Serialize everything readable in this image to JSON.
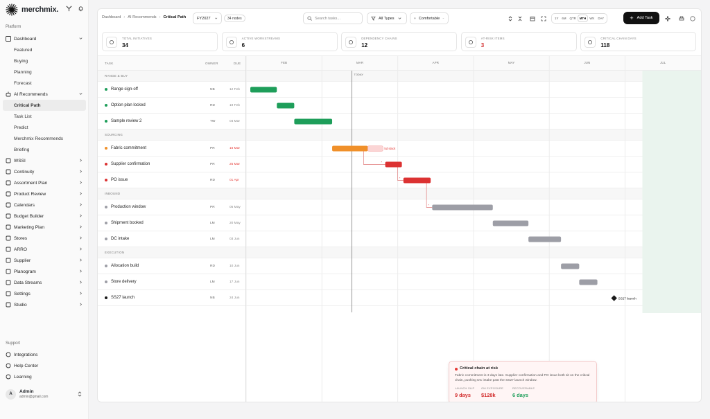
{
  "brand": {
    "name": "merchmix."
  },
  "sidebar": {
    "platform_label": "Platform",
    "support_label": "Support",
    "dashboard": {
      "label": "Dashboard",
      "children": [
        "Featured",
        "Buying",
        "Planning",
        "Forecast"
      ]
    },
    "ai": {
      "label": "AI Recommends",
      "children": [
        "Critical Path",
        "Task List",
        "Predict",
        "Merchmix Recommends",
        "Briefing"
      ]
    },
    "items": [
      "WSSI",
      "Continuity",
      "Assortment Plan",
      "Product Review",
      "Calendars",
      "Budget Builder",
      "Marketing Plan",
      "Stores",
      "ARRO",
      "Supplier",
      "Planogram",
      "Data Streams",
      "Settings",
      "Studio"
    ],
    "support": [
      "Integrations",
      "Help Center",
      "Learning"
    ],
    "user": {
      "initial": "A",
      "name": "Admin",
      "email": "admin@gmail.com"
    }
  },
  "topbar": {
    "crumbs": [
      "Dashboard",
      "AI Recommends",
      "Critical Path"
    ],
    "year": "FY2027",
    "nodes": "34 nodes",
    "search_placeholder": "Search tasks...",
    "filter": "All Types",
    "density": "Comfortable",
    "ranges": [
      "1Y",
      "6M",
      "QTR",
      "MTH",
      "WK",
      "DAY"
    ],
    "range_active": "MTH",
    "add_label": "Add Task"
  },
  "kpis": [
    {
      "label": "TOTAL INITIATIVES",
      "value": "34",
      "icon": "layers-icon",
      "tone": "normal"
    },
    {
      "label": "ACTIVE WORKSTREAMS",
      "value": "6",
      "icon": "pulse-icon",
      "tone": "normal"
    },
    {
      "label": "DEPENDENCY CHAINS",
      "value": "12",
      "icon": "link-icon",
      "tone": "normal"
    },
    {
      "label": "AT-RISK ITEMS",
      "value": "3",
      "icon": "warning-icon",
      "tone": "red"
    },
    {
      "label": "CRITICAL CHAIN DAYS",
      "value": "118",
      "icon": "swap-icon",
      "tone": "normal"
    }
  ],
  "gantt": {
    "headers": {
      "task": "TASK",
      "owner": "OWNER",
      "due": "DUE"
    },
    "months": [
      "FEB",
      "MAR",
      "APR",
      "MAY",
      "JUN",
      "JUL"
    ],
    "today_label": "TODAY",
    "slack_label": "5d slack",
    "milestone_label": "SS27 launch",
    "rows": [
      {
        "kind": "group",
        "label": "RANGE & BUY"
      },
      {
        "kind": "task",
        "name": "Range sign-off",
        "owner": "NB",
        "due": "12 Feb",
        "due_red": false,
        "status": "green",
        "start": 0.0,
        "end": 0.35
      },
      {
        "kind": "task",
        "name": "Option plan locked",
        "owner": "RD",
        "due": "19 Feb",
        "due_red": false,
        "status": "green",
        "start": 0.35,
        "end": 0.58
      },
      {
        "kind": "task",
        "name": "Sample review 2",
        "owner": "TW",
        "due": "04 Mar",
        "due_red": false,
        "status": "green",
        "start": 0.58,
        "end": 1.08
      },
      {
        "kind": "group",
        "label": "SOURCING"
      },
      {
        "kind": "task",
        "name": "Fabric commitment",
        "owner": "PR",
        "due": "16 Mar",
        "due_red": true,
        "status": "orange",
        "start": 1.08,
        "end": 1.55,
        "slack_end": 1.75
      },
      {
        "kind": "task",
        "name": "Supplier confirmation",
        "owner": "PR",
        "due": "25 Mar",
        "due_red": true,
        "status": "red",
        "start": 1.78,
        "end": 2.0
      },
      {
        "kind": "task",
        "name": "PO issue",
        "owner": "RD",
        "due": "01 Apr",
        "due_red": true,
        "status": "red",
        "start": 2.02,
        "end": 2.38
      },
      {
        "kind": "group",
        "label": "INBOUND"
      },
      {
        "kind": "task",
        "name": "Production window",
        "owner": "PR",
        "due": "05 May",
        "due_red": false,
        "status": "gray",
        "start": 2.4,
        "end": 3.2
      },
      {
        "kind": "task",
        "name": "Shipment booked",
        "owner": "LM",
        "due": "20 May",
        "due_red": false,
        "status": "gray",
        "start": 3.2,
        "end": 3.67
      },
      {
        "kind": "task",
        "name": "DC intake",
        "owner": "LM",
        "due": "03 Jun",
        "due_red": false,
        "status": "gray",
        "start": 3.67,
        "end": 4.1
      },
      {
        "kind": "group",
        "label": "EXECUTION"
      },
      {
        "kind": "task",
        "name": "Allocation build",
        "owner": "RD",
        "due": "10 Jun",
        "due_red": false,
        "status": "gray",
        "start": 4.1,
        "end": 4.34
      },
      {
        "kind": "task",
        "name": "Store delivery",
        "owner": "LM",
        "due": "17 Jun",
        "due_red": false,
        "status": "gray",
        "start": 4.34,
        "end": 4.58
      },
      {
        "kind": "task",
        "name": "SS27 launch",
        "owner": "NB",
        "due": "24 Jun",
        "due_red": false,
        "status": "dark",
        "milestone": 4.8
      }
    ]
  },
  "risk": {
    "title": "Critical chain at risk",
    "body": "Fabric commitment is 3 days late. Supplier confirmation and PO issue both sit on the critical chain, pushing DC intake past the SS27 launch window.",
    "metrics": [
      {
        "label": "LAUNCH SLIP",
        "value": "9 days",
        "tone": "red"
      },
      {
        "label": "GM EXPOSURE",
        "value": "$128k",
        "tone": "red"
      },
      {
        "label": "RECOVERABLE",
        "value": "6 days",
        "tone": "green"
      }
    ]
  },
  "colors": {
    "green": "#1e9e5a",
    "orange": "#f0902a",
    "red": "#dc3232",
    "gray": "#9d9ea6",
    "dark": "#1a1a1a",
    "accent": "#111111"
  }
}
